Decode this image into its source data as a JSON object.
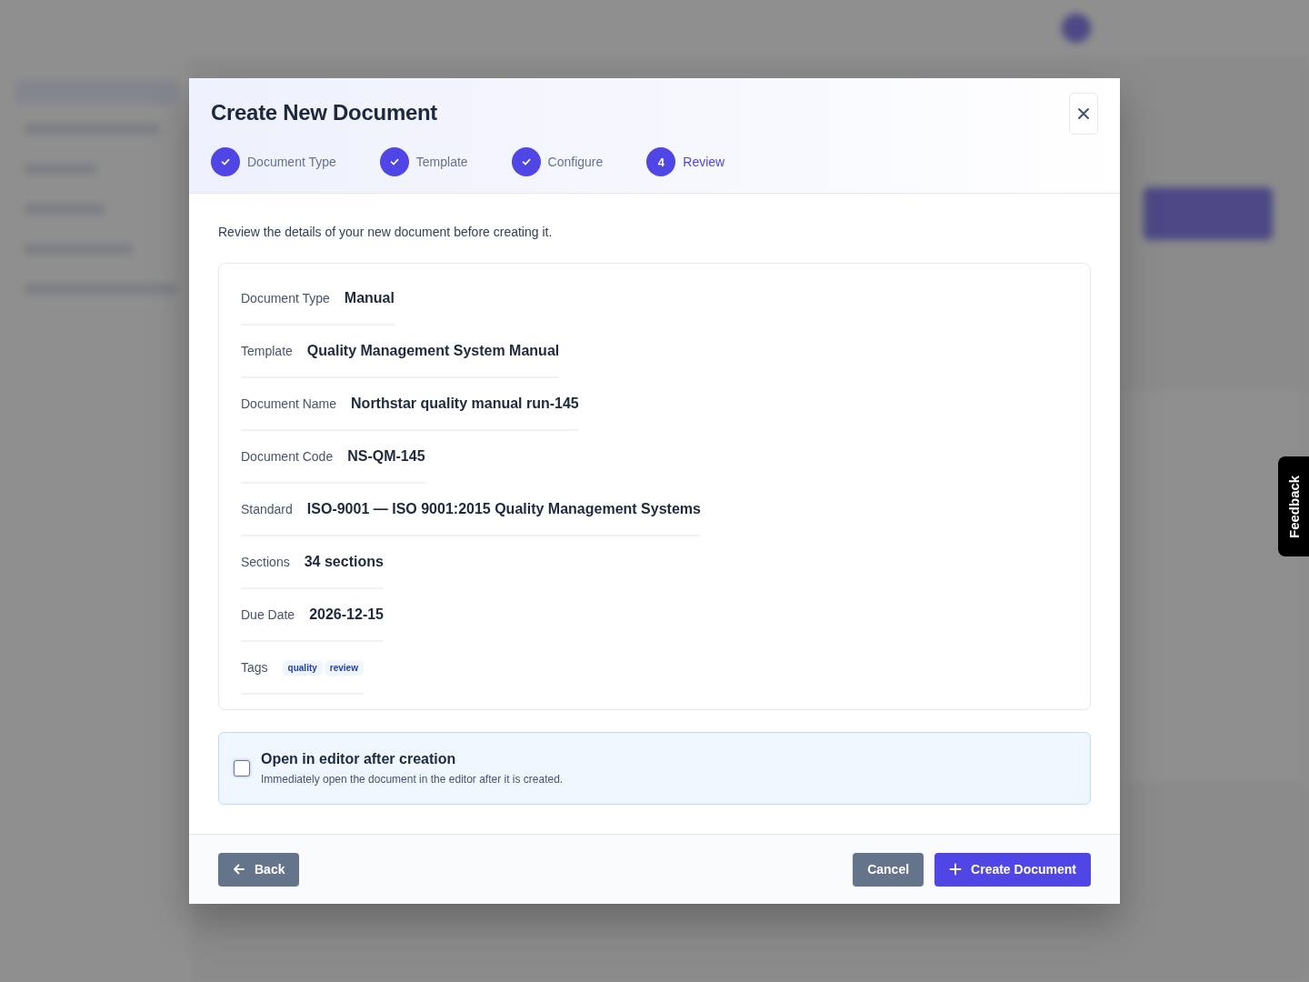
{
  "dialog": {
    "title": "Create New Document",
    "steps": [
      {
        "label": "Document Type",
        "completed": true,
        "selected": false
      },
      {
        "label": "Template",
        "completed": true,
        "selected": false
      },
      {
        "label": "Configure",
        "completed": true,
        "selected": false
      },
      {
        "label": "Review",
        "number": "4",
        "completed": false,
        "selected": true
      }
    ],
    "intro": "Review the details of your new document before creating it.",
    "details": [
      {
        "label": "Document Type",
        "value": "Manual"
      },
      {
        "label": "Template",
        "value": "Quality Management System Manual"
      },
      {
        "label": "Document Name",
        "value": "Northstar quality manual run-145"
      },
      {
        "label": "Document Code",
        "value": "NS-QM-145"
      },
      {
        "label": "Standard",
        "value": "ISO-9001 — ISO 9001:2015 Quality Management Systems"
      },
      {
        "label": "Sections",
        "value": "34 sections"
      },
      {
        "label": "Due Date",
        "value": "2026-12-15"
      },
      {
        "label": "Tags",
        "tags": [
          "quality",
          "review"
        ]
      }
    ],
    "option": {
      "title": "Open in editor after creation",
      "description": "Immediately open the document in the editor after it is created.",
      "checked": false
    },
    "buttons": {
      "back": "Back",
      "cancel": "Cancel",
      "create": "Create Document"
    }
  },
  "feedback_tab": "Feedback"
}
